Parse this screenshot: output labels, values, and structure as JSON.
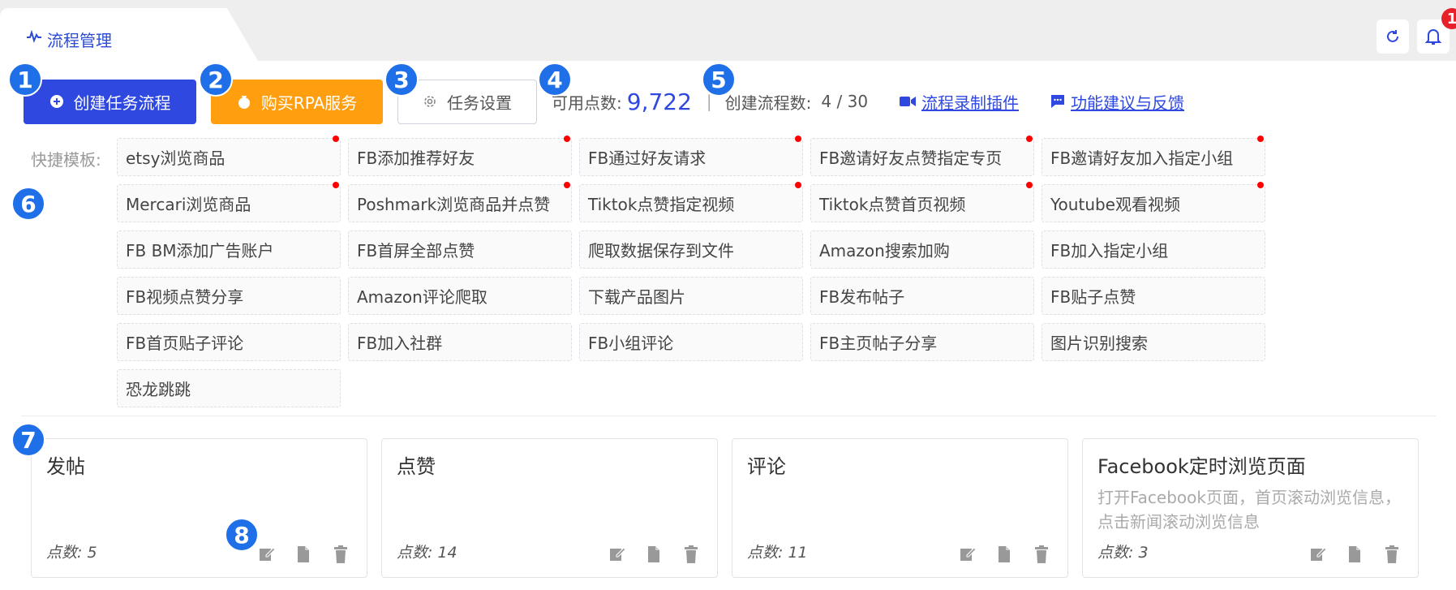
{
  "header": {
    "tab_label": "流程管理",
    "notification_count": "1"
  },
  "toolbar": {
    "create_label": "创建任务流程",
    "buy_label": "购买RPA服务",
    "settings_label": "任务设置",
    "points_label": "可用点数:",
    "points_value": "9,722",
    "flows_label": "创建流程数:",
    "flows_value": "4 / 30",
    "record_plugin_label": "流程录制插件",
    "feedback_label": "功能建议与反馈"
  },
  "templates": {
    "label": "快捷模板:",
    "items": [
      {
        "name": "etsy浏览商品",
        "dot": true
      },
      {
        "name": "FB添加推荐好友",
        "dot": true
      },
      {
        "name": "FB通过好友请求",
        "dot": true
      },
      {
        "name": "FB邀请好友点赞指定专页",
        "dot": true
      },
      {
        "name": "FB邀请好友加入指定小组",
        "dot": true
      },
      {
        "name": "Mercari浏览商品",
        "dot": true
      },
      {
        "name": "Poshmark浏览商品并点赞",
        "dot": true
      },
      {
        "name": "Tiktok点赞指定视频",
        "dot": true
      },
      {
        "name": "Tiktok点赞首页视频",
        "dot": true
      },
      {
        "name": "Youtube观看视频",
        "dot": true
      },
      {
        "name": "FB BM添加广告账户",
        "dot": false
      },
      {
        "name": "FB首屏全部点赞",
        "dot": false
      },
      {
        "name": "爬取数据保存到文件",
        "dot": false
      },
      {
        "name": "Amazon搜索加购",
        "dot": false
      },
      {
        "name": "FB加入指定小组",
        "dot": false
      },
      {
        "name": "FB视频点赞分享",
        "dot": false
      },
      {
        "name": "Amazon评论爬取",
        "dot": false
      },
      {
        "name": "下载产品图片",
        "dot": false
      },
      {
        "name": "FB发布帖子",
        "dot": false
      },
      {
        "name": "FB贴子点赞",
        "dot": false
      },
      {
        "name": "FB首页贴子评论",
        "dot": false
      },
      {
        "name": "FB加入社群",
        "dot": false
      },
      {
        "name": "FB小组评论",
        "dot": false
      },
      {
        "name": "FB主页帖子分享",
        "dot": false
      },
      {
        "name": "图片识别搜索",
        "dot": false
      },
      {
        "name": "恐龙跳跳",
        "dot": false
      }
    ]
  },
  "cards": [
    {
      "title": "发帖",
      "desc": "",
      "points_label": "点数:",
      "points": "5"
    },
    {
      "title": "点赞",
      "desc": "",
      "points_label": "点数:",
      "points": "14"
    },
    {
      "title": "评论",
      "desc": "",
      "points_label": "点数:",
      "points": "11"
    },
    {
      "title": "Facebook定时浏览页面",
      "desc": "打开Facebook页面，首页滚动浏览信息，点击新闻滚动浏览信息",
      "points_label": "点数:",
      "points": "3"
    }
  ],
  "markers": [
    "1",
    "2",
    "3",
    "4",
    "5",
    "6",
    "7",
    "8"
  ],
  "colors": {
    "primary": "#2f48e0",
    "orange": "#ff9f10",
    "marker": "#1f6fe8",
    "badge": "#e8202a"
  }
}
